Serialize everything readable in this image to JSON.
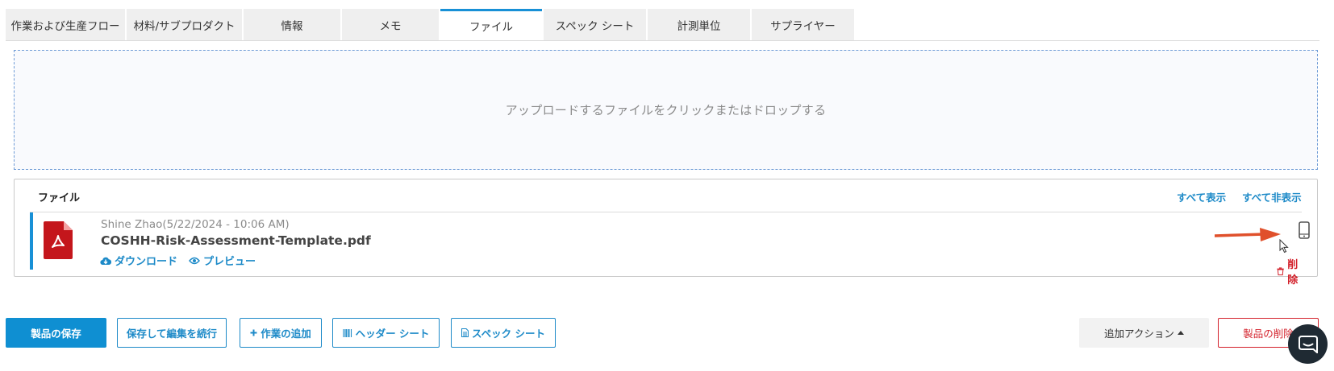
{
  "tabs": [
    {
      "label": "作業および生産フロー",
      "active": false
    },
    {
      "label": "材料/サブプロダクト",
      "active": false
    },
    {
      "label": "情報",
      "active": false
    },
    {
      "label": "メモ",
      "active": false
    },
    {
      "label": "ファイル",
      "active": true
    },
    {
      "label": "スペック シート",
      "active": false
    },
    {
      "label": "計測単位",
      "active": false
    },
    {
      "label": "サプライヤー",
      "active": false
    }
  ],
  "dropzone": {
    "text": "アップロードするファイルをクリックまたはドロップする"
  },
  "files_panel": {
    "title": "ファイル",
    "show_all": "すべて表示",
    "hide_all": "すべて非表示",
    "file": {
      "meta": "Shine Zhao(5/22/2024 - 10:06 AM)",
      "name": "COSHH-Risk-Assessment-Template.pdf",
      "download": "ダウンロード",
      "preview": "プレビュー",
      "delete": "削除",
      "icon": "pdf-file-icon"
    }
  },
  "buttons": {
    "save_product": "製品の保存",
    "save_continue": "保存して編集を続行",
    "add_work": "作業の追加",
    "header_sheet": "ヘッダー シート",
    "spec_sheet": "スペック シート",
    "more_actions": "追加アクション",
    "delete_product": "製品の削除"
  },
  "colors": {
    "accent": "#1890d6",
    "link": "#1d8ac8",
    "danger": "#d3212b",
    "pdf_red": "#c4161c",
    "annotation_arrow": "#e0502b",
    "chat_bubble": "#1f2a33"
  }
}
